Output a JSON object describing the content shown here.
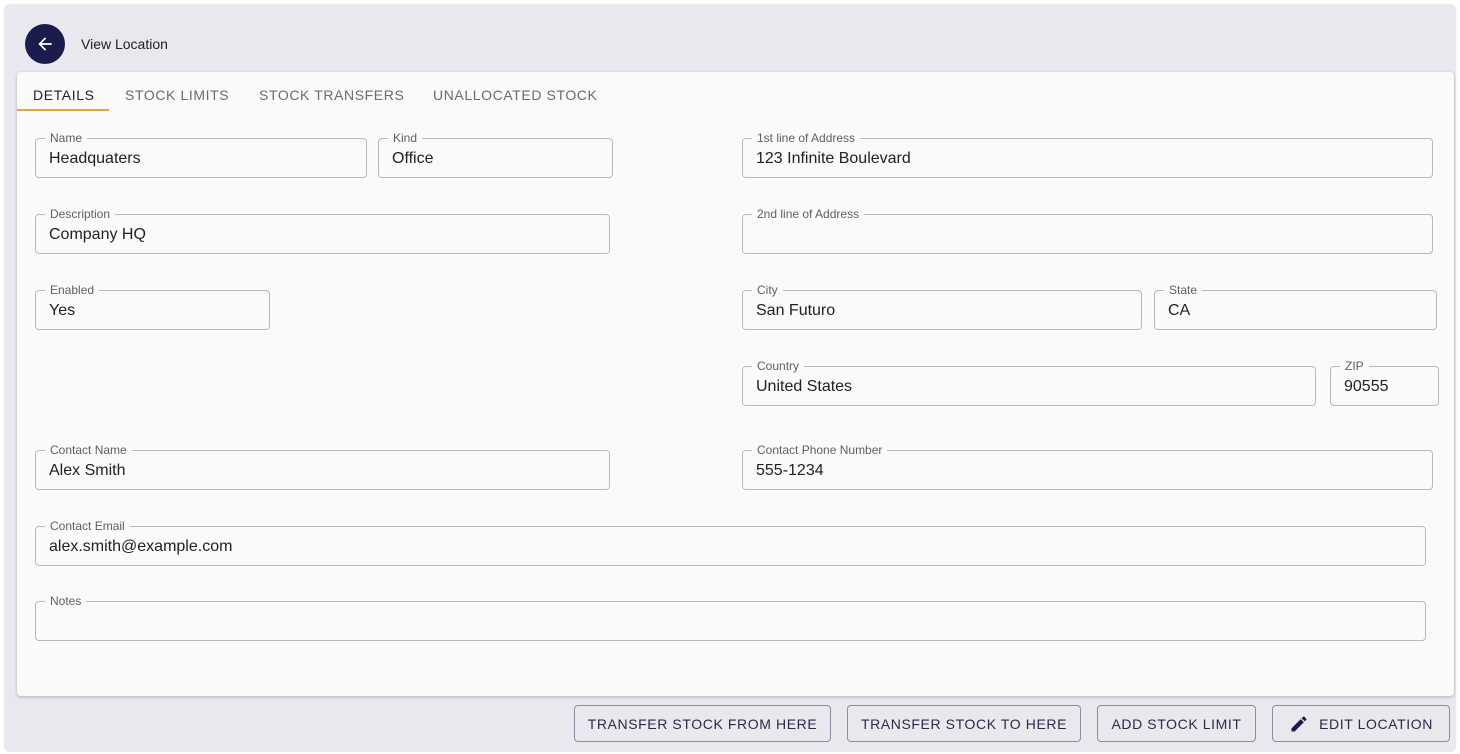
{
  "header": {
    "title": "View Location"
  },
  "tabs": [
    {
      "label": "DETAILS"
    },
    {
      "label": "STOCK LIMITS"
    },
    {
      "label": "STOCK TRANSFERS"
    },
    {
      "label": "UNALLOCATED STOCK"
    }
  ],
  "active_tab": "DETAILS",
  "fields": {
    "name": {
      "label": "Name",
      "value": "Headquaters"
    },
    "kind": {
      "label": "Kind",
      "value": "Office"
    },
    "description": {
      "label": "Description",
      "value": "Company HQ"
    },
    "enabled": {
      "label": "Enabled",
      "value": "Yes"
    },
    "address1": {
      "label": "1st line of Address",
      "value": "123 Infinite Boulevard"
    },
    "address2": {
      "label": "2nd line of Address",
      "value": ""
    },
    "city": {
      "label": "City",
      "value": "San Futuro"
    },
    "state": {
      "label": "State",
      "value": "CA"
    },
    "country": {
      "label": "Country",
      "value": "United States"
    },
    "zip": {
      "label": "ZIP",
      "value": "90555"
    },
    "contact_name": {
      "label": "Contact Name",
      "value": "Alex Smith"
    },
    "contact_phone": {
      "label": "Contact Phone Number",
      "value": "555-1234"
    },
    "contact_email": {
      "label": "Contact Email",
      "value": "alex.smith@example.com"
    },
    "notes": {
      "label": "Notes",
      "value": ""
    }
  },
  "actions": {
    "transfer_from": "TRANSFER STOCK FROM HERE",
    "transfer_to": "TRANSFER STOCK TO HERE",
    "add_limit": "ADD STOCK LIMIT",
    "edit": "EDIT LOCATION"
  },
  "icons": {
    "back": "arrow-back-icon",
    "edit": "pencil-icon"
  },
  "colors": {
    "accent_dark": "#1c1b4d",
    "tab_indicator": "#e8a33b"
  }
}
